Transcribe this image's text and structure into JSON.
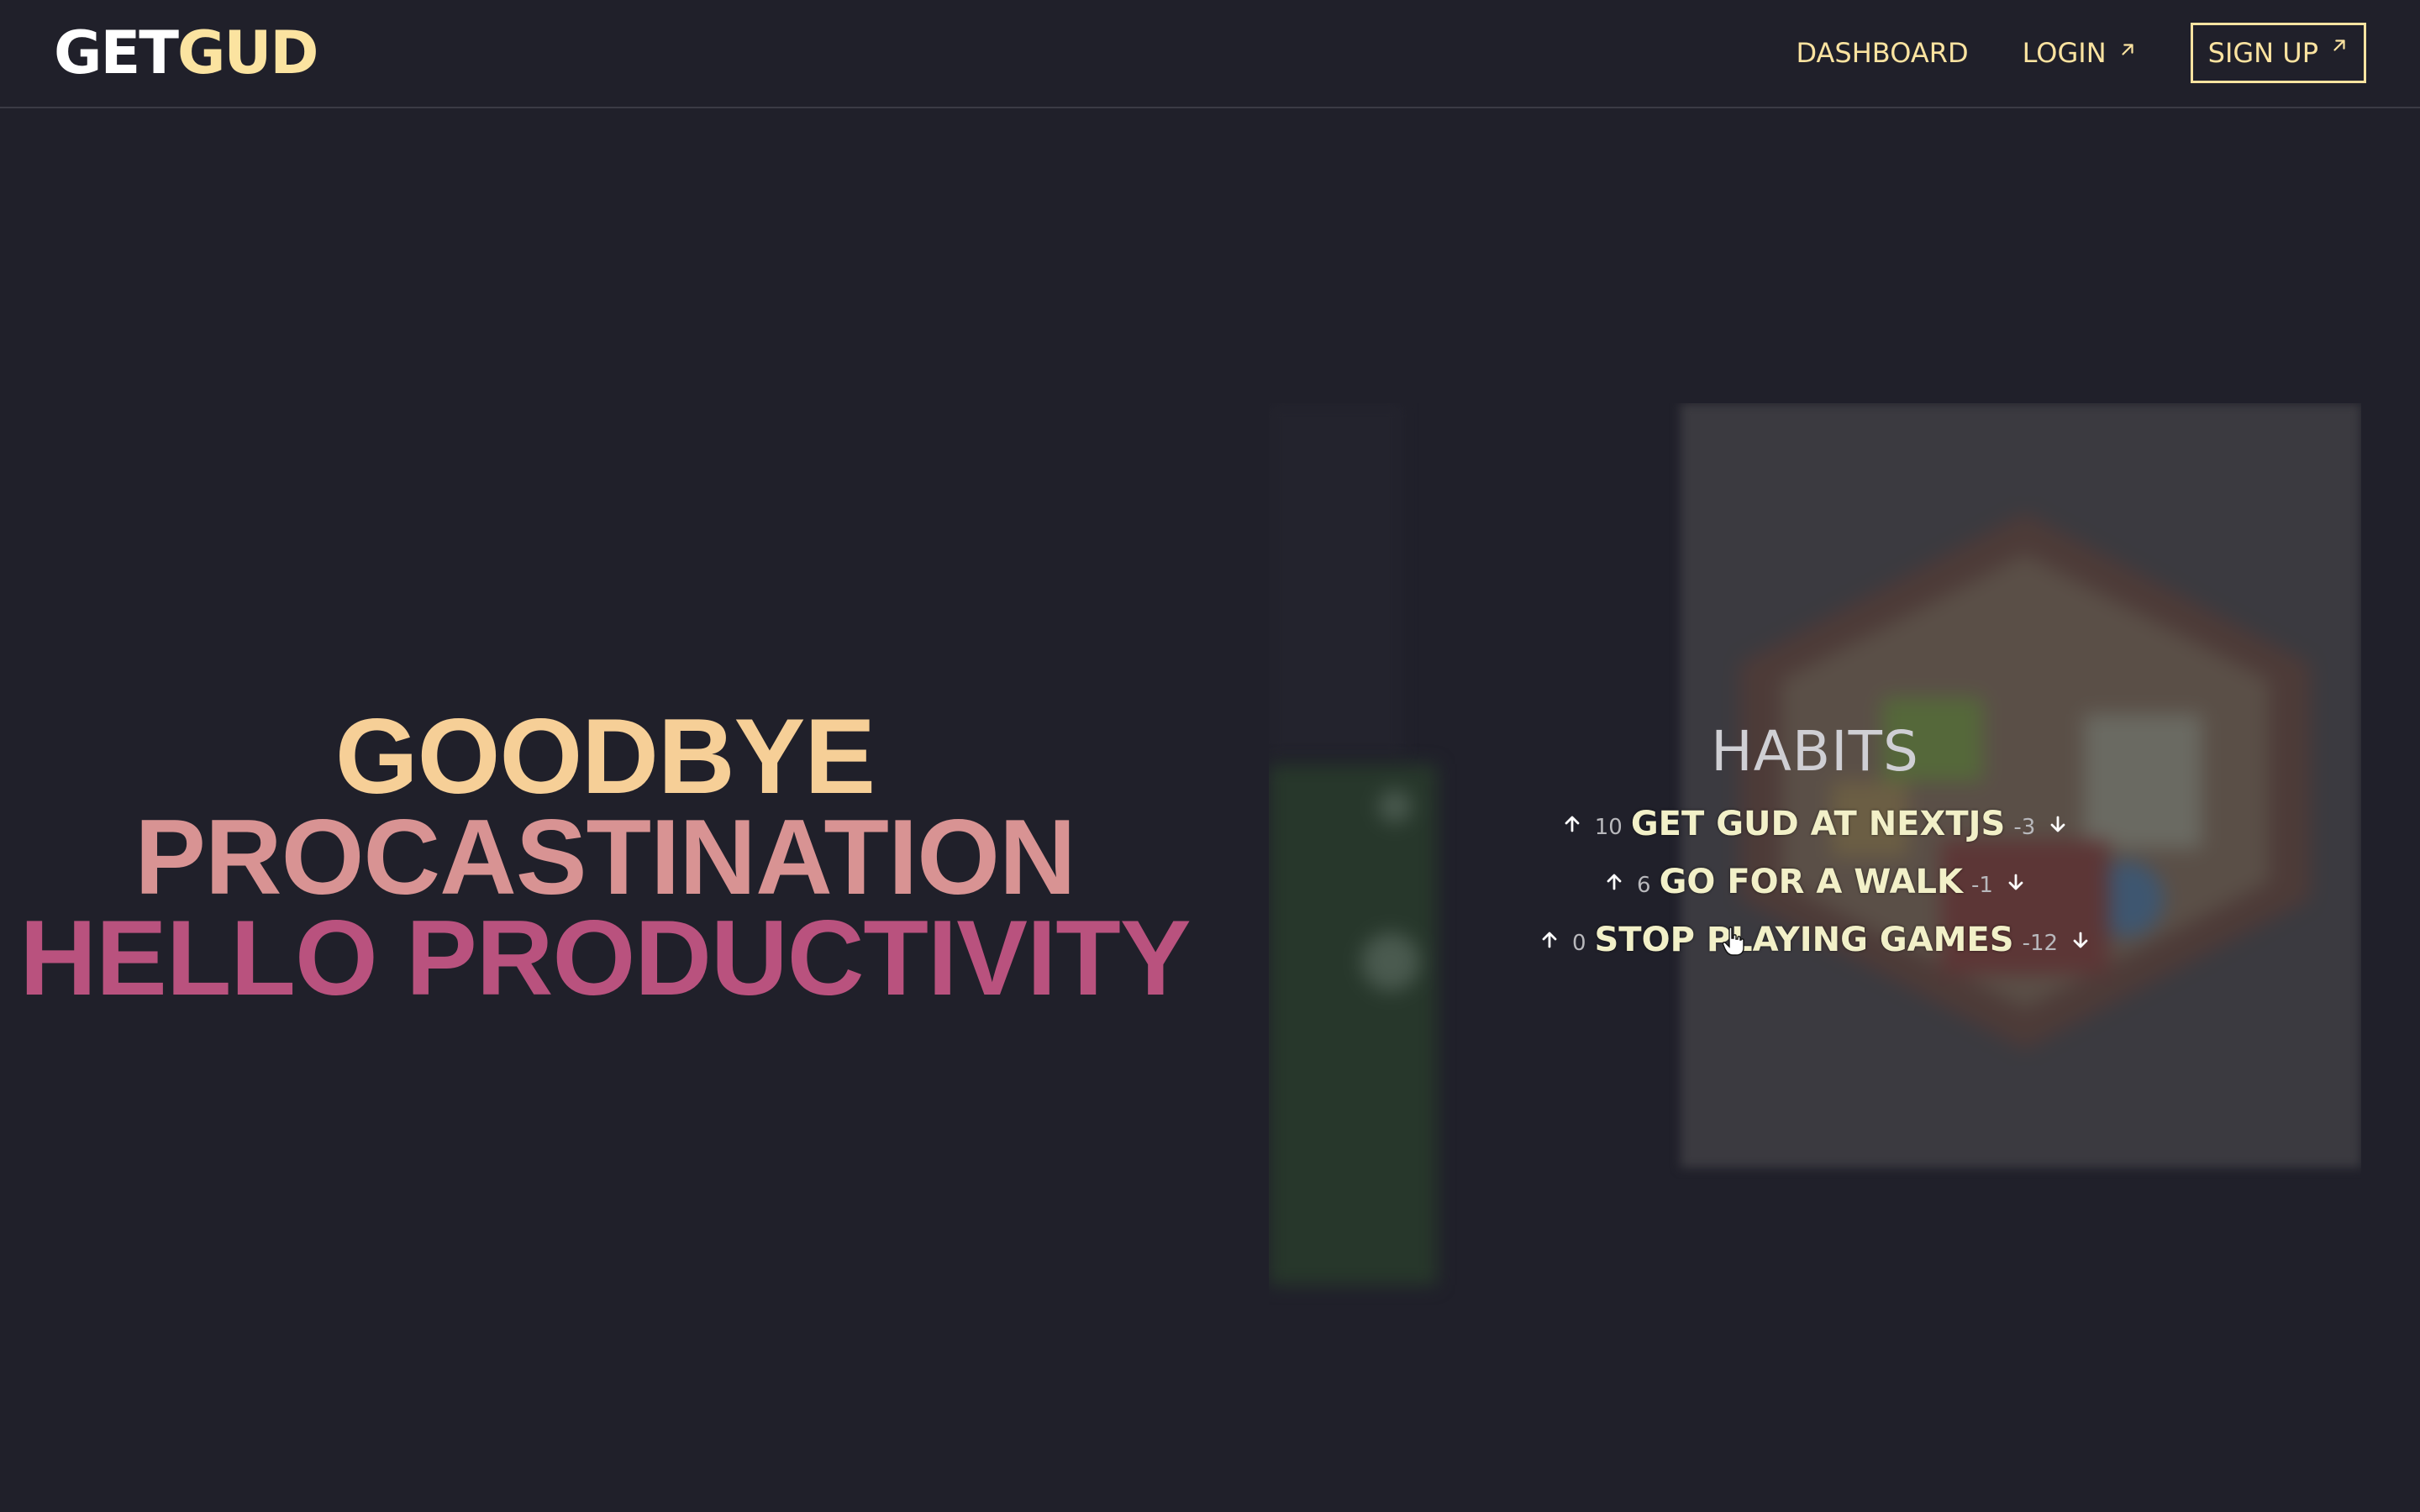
{
  "header": {
    "logo_get": "GET",
    "logo_gud": "GUD",
    "nav": {
      "dashboard": "DASHBOARD",
      "login": "LOGIN",
      "signup": "SIGN UP"
    }
  },
  "hero": {
    "line1": "GOODBYE",
    "line2": "PROCASTINATION",
    "line3": "HELLO PRODUCTIVITY"
  },
  "habits": {
    "title": "HABITS",
    "items": [
      {
        "up_count": "10",
        "name": "GET GUD AT NEXTJS",
        "down_count": "-3"
      },
      {
        "up_count": "6",
        "name": "GO FOR A WALK",
        "down_count": "-1"
      },
      {
        "up_count": "0",
        "name": "STOP PLAYING GAMES",
        "down_count": "-12"
      }
    ]
  },
  "icons": {
    "external": "arrow-up-right-icon",
    "upvote": "arrow-up-icon",
    "downvote": "arrow-down-icon",
    "cursor": "hand-pointer-icon"
  },
  "colors": {
    "background": "#20202a",
    "accent": "#fbe3a0",
    "hero_gradient": [
      "#f6cf97",
      "#d89393",
      "#b9527e"
    ]
  }
}
